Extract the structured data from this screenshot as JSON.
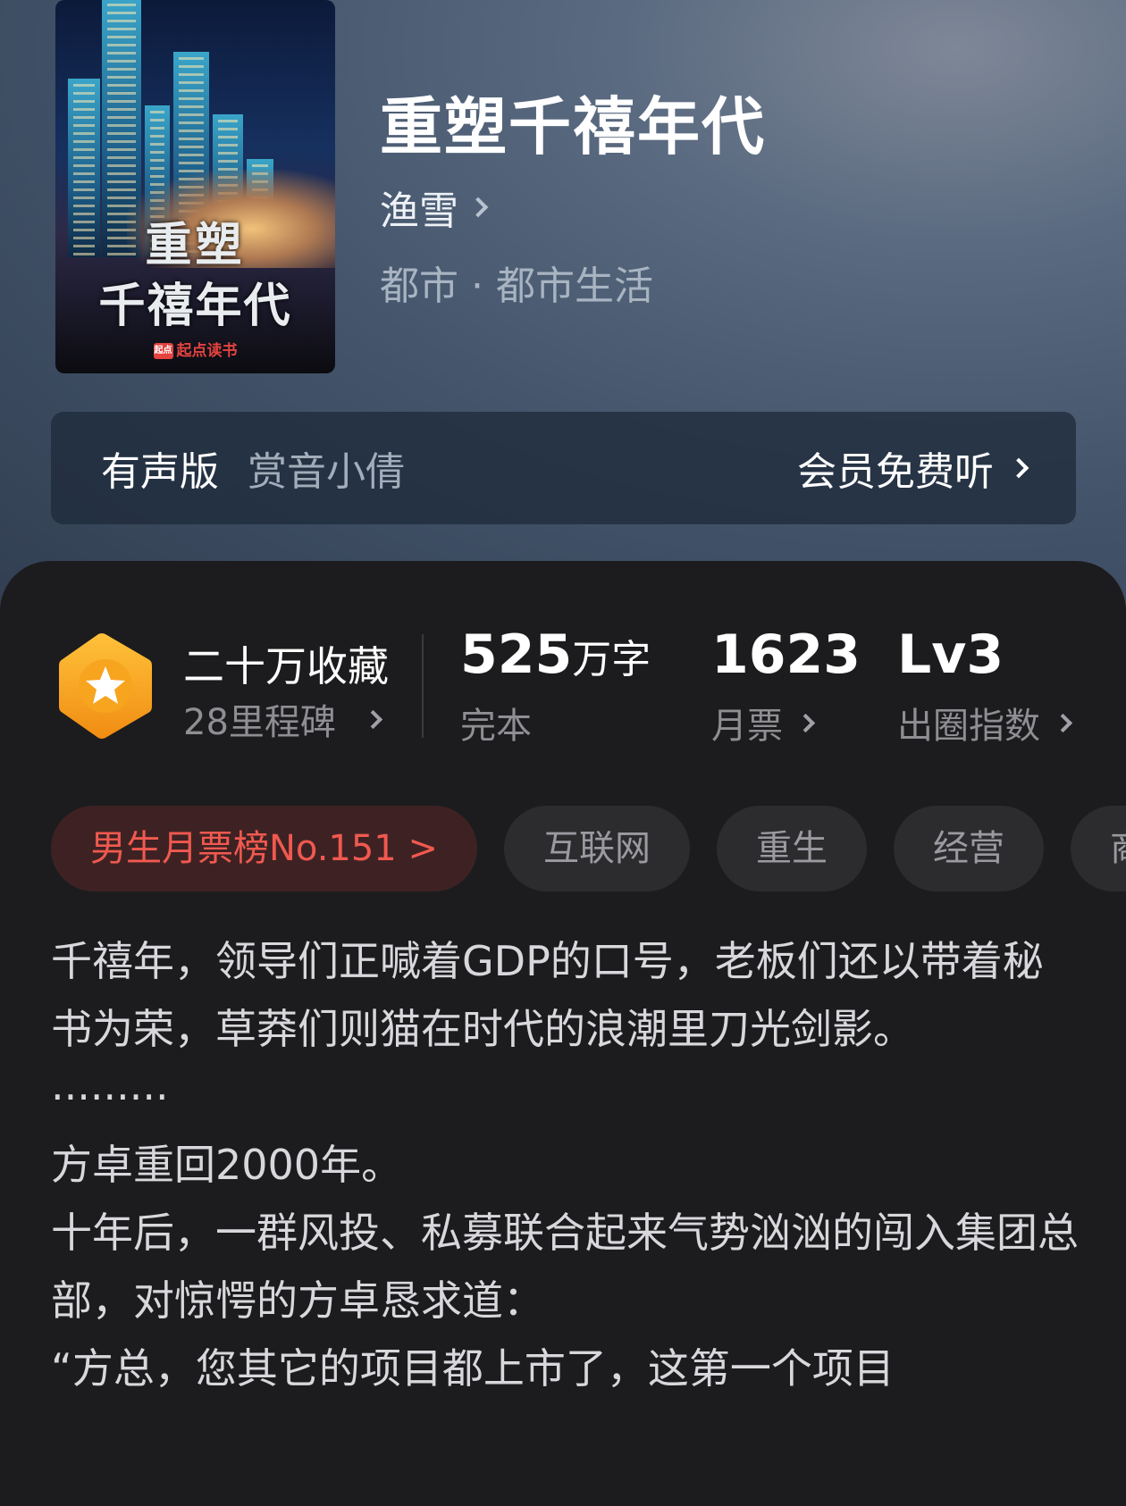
{
  "book": {
    "title": "重塑千禧年代",
    "author": "渔雪",
    "genre": "都市 · 都市生活",
    "cover": {
      "title_line1": "重塑",
      "title_line2": "千禧年代",
      "publisher": "起点读书",
      "publisher_logo": "起点"
    }
  },
  "audio": {
    "label": "有声版",
    "narrator": "赏音小倩",
    "cta": "会员免费听"
  },
  "stats": {
    "collect_title": "二十万收藏",
    "collect_sub": "28里程碑",
    "words_value": "525",
    "words_unit": "万字",
    "words_label": "完本",
    "monthly_value": "1623",
    "monthly_label": "月票",
    "level_value": "Lv3",
    "level_label": "出圈指数"
  },
  "tags": [
    "男生月票榜No.151 >",
    "互联网",
    "重生",
    "经营",
    "商"
  ],
  "synopsis": [
    "千禧年，领导们正喊着GDP的口号，老板们还以带着秘书为荣，草莽们则猫在时代的浪潮里刀光剑影。",
    "·········",
    "方卓重回2000年。",
    "十年后，一群风投、私募联合起来气势汹汹的闯入集团总部，对惊愕的方卓恳求道：",
    "“方总，您其它的项目都上市了，这第一个项目"
  ],
  "colors": {
    "accent_red": "#f0594f",
    "badge_orange": "#f5a623",
    "background": "#1c1c1e"
  },
  "icons": {
    "badge": "hexagon-star-icon",
    "chevron": "chevron-right-icon"
  }
}
